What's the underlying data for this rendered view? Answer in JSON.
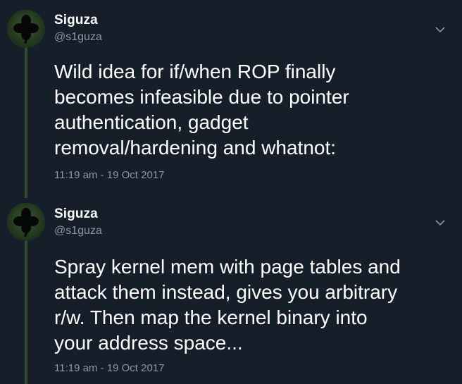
{
  "colors": {
    "background": "#151e29",
    "text_primary": "#ffffff",
    "text_secondary": "#8899a6",
    "thread_line": "#2f4f2c"
  },
  "tweets": [
    {
      "display_name": "Siguza",
      "handle": "@s1guza",
      "avatar_icon": "four-leaf-clover-avatar",
      "menu_icon": "chevron-down-icon",
      "text": "Wild idea for if/when ROP finally\nbecomes infeasible due to pointer\nauthentication, gadget\nremoval/hardening and whatnot:",
      "timestamp": "11:19 am - 19 Oct 2017"
    },
    {
      "display_name": "Siguza",
      "handle": "@s1guza",
      "avatar_icon": "four-leaf-clover-avatar",
      "menu_icon": "chevron-down-icon",
      "text": "Spray kernel mem with page tables and\nattack them instead, gives you arbitrary\nr/w. Then map the kernel binary into\nyour address space...",
      "timestamp": "11:19 am - 19 Oct 2017"
    }
  ]
}
